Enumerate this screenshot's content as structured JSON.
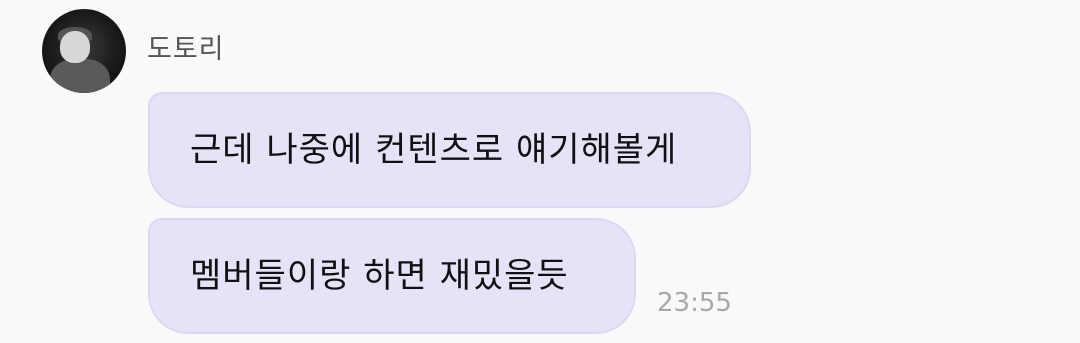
{
  "sender": {
    "name": "도토리",
    "avatar_icon": "profile-photo"
  },
  "messages": [
    {
      "text": "근데 나중에 컨텐츠로 얘기해볼게"
    },
    {
      "text": "멤버들이랑 하면 재밌을듯"
    }
  ],
  "timestamp": "23:55",
  "colors": {
    "bubble": "#e6e3f8",
    "background": "#f9f9f9",
    "timestamp": "#a8a8a8"
  }
}
